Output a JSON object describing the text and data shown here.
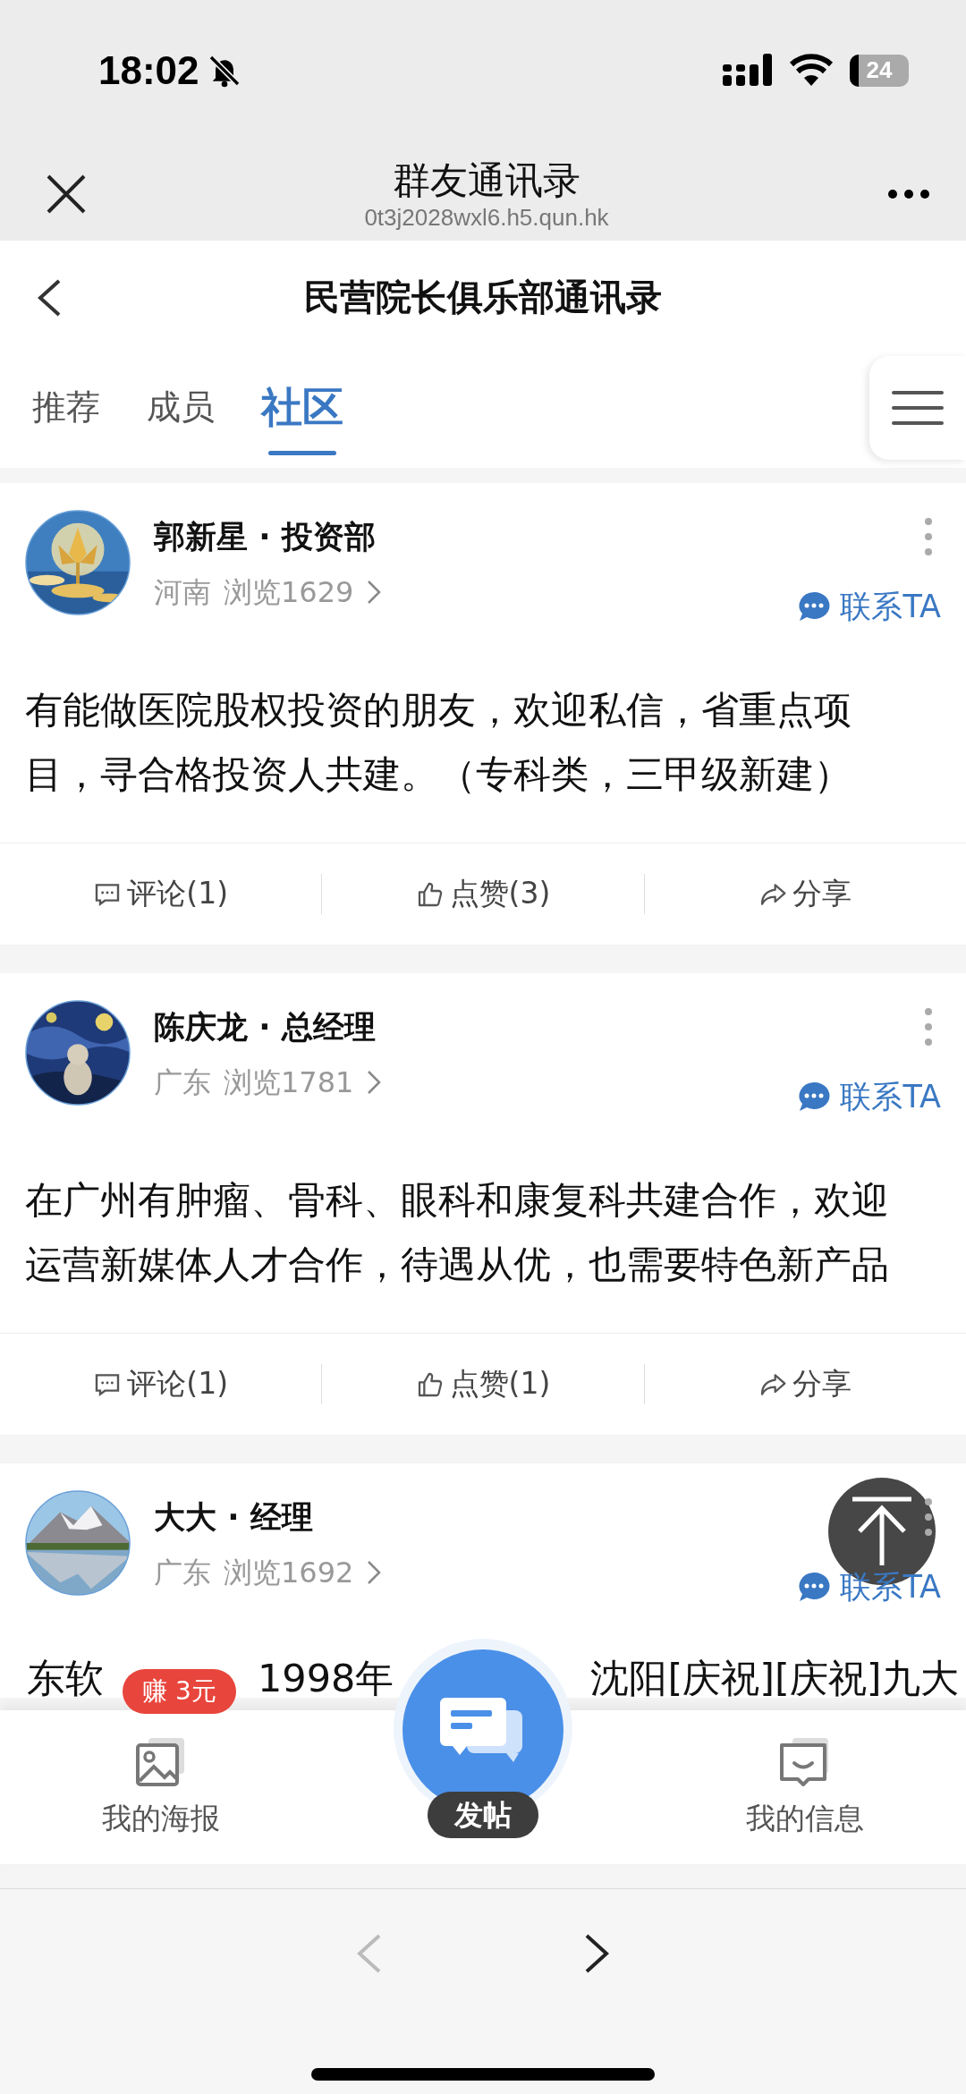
{
  "status_bar": {
    "time": "18:02",
    "battery": "24"
  },
  "browser": {
    "title": "群友通讯录",
    "url": "0t3j2028wxl6.h5.qun.hk",
    "back_disabled": true,
    "forward_disabled": false
  },
  "nav": {
    "title": "民营院长俱乐部通讯录"
  },
  "tabs": [
    {
      "label": "推荐",
      "selected": false
    },
    {
      "label": "成员",
      "selected": false
    },
    {
      "label": "社区",
      "selected": true
    }
  ],
  "posts": [
    {
      "author": "郭新星 · 投资部",
      "region": "河南",
      "views": "浏览1629",
      "contact": "联系TA",
      "body": "有能做医院股权投资的朋友，欢迎私信，省重点项目，寻合格投资人共建。（专科类，三甲级新建）",
      "actions": [
        {
          "kind": "comment",
          "label": "评论(1)"
        },
        {
          "kind": "like",
          "label": "点赞(3)"
        },
        {
          "kind": "share",
          "label": "分享"
        }
      ]
    },
    {
      "author": "陈庆龙 · 总经理",
      "region": "广东",
      "views": "浏览1781",
      "contact": "联系TA",
      "body": "在广州有肿瘤、骨科、眼科和康复科共建合作，欢迎运营新媒体人才合作，待遇从优，也需要特色新产品",
      "actions": [
        {
          "kind": "comment",
          "label": "评论(1)"
        },
        {
          "kind": "like",
          "label": "点赞(1)"
        },
        {
          "kind": "share",
          "label": "分享"
        }
      ]
    },
    {
      "author": "大大 · 经理",
      "region": "广东",
      "views": "浏览1692",
      "contact": "联系TA",
      "body_fragments": [
        "东软",
        "1998年",
        "沈阳[庆祝][庆祝]九大"
      ]
    }
  ],
  "bottom_bar": {
    "items": [
      {
        "kind": "poster",
        "label": "我的海报",
        "badge": "赚 3元"
      },
      {
        "kind": "post",
        "label": "发帖"
      },
      {
        "kind": "messages",
        "label": "我的信息"
      }
    ]
  }
}
